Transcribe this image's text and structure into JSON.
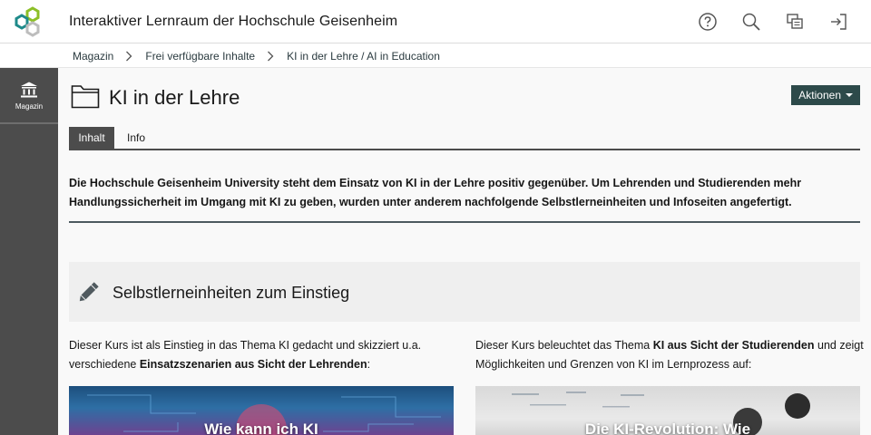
{
  "header": {
    "app_title": "Interaktiver Lernraum der Hochschule Geisenheim",
    "icons": [
      "help-icon",
      "search-icon",
      "notifications-icon",
      "login-icon"
    ]
  },
  "breadcrumb": {
    "items": [
      "Magazin",
      "Frei verfügbare Inhalte",
      "KI in der Lehre / AI in Education"
    ]
  },
  "sidebar": {
    "items": [
      {
        "label": "Magazin",
        "icon": "repository-icon"
      }
    ]
  },
  "page": {
    "title": "KI in der Lehre",
    "actions_label": "Aktionen",
    "tabs": [
      {
        "label": "Inhalt",
        "active": true
      },
      {
        "label": "Info",
        "active": false
      }
    ],
    "intro": "Die Hochschule Geisenheim University steht dem Einsatz von KI in der Lehre positiv gegenüber. Um Lehrenden und Studierenden mehr Handlungssicherheit im Umgang mit KI zu geben, wurden unter anderem nachfolgende Selbstlerneinheiten und Infoseiten angefertigt.",
    "section_title": "Selbstlerneinheiten zum Einstieg",
    "left_course": {
      "text_pre": "Dieser Kurs ist als Einstieg in das Thema KI gedacht und skizziert u.a. verschiedene ",
      "text_bold": "Einsatzszenarien aus Sicht der Lehrenden",
      "text_post": ":",
      "image_caption": "Wie kann ich KI"
    },
    "right_course": {
      "text_pre": "Dieser Kurs beleuchtet das Thema ",
      "text_bold": "KI aus Sicht der Studierenden",
      "text_post": " und zeigt Möglichkeiten und Grenzen von KI im Lernprozess auf:",
      "image_caption": "Die KI-Revolution: Wie"
    }
  },
  "colors": {
    "accent": "#2d4a4a",
    "sidebar": "#4c4c4c",
    "logo_green": "#8cbf26",
    "logo_teal": "#1e8a8a"
  }
}
